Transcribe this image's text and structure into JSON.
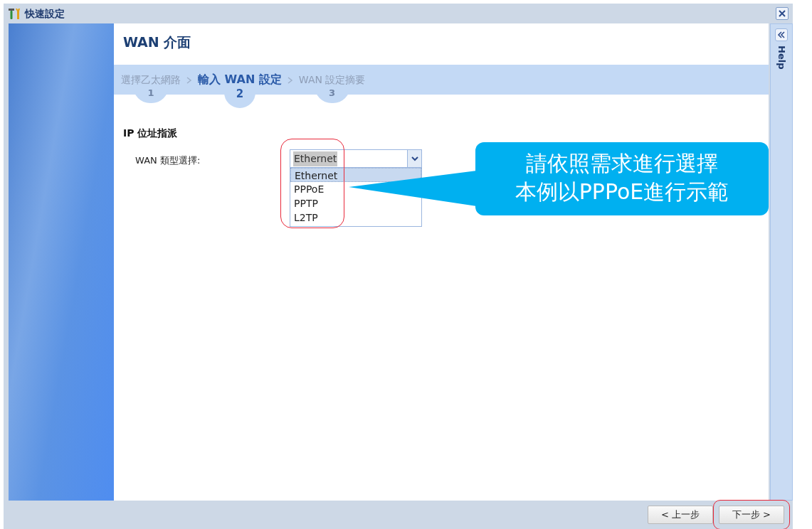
{
  "window": {
    "title": "快速設定"
  },
  "page_title": "WAN 介面",
  "steps": [
    {
      "label": "選擇乙太網路",
      "number": "1",
      "selected": false
    },
    {
      "label": "輸入 WAN 設定",
      "number": "2",
      "selected": true
    },
    {
      "label": "WAN 設定摘要",
      "number": "3",
      "selected": false
    }
  ],
  "section_title": "IP 位址指派",
  "wan_type": {
    "label": "WAN 類型選擇:",
    "value": "Ethernet",
    "expanded": true,
    "options": [
      {
        "label": "Ethernet",
        "selected": true
      },
      {
        "label": "PPPoE",
        "selected": false
      },
      {
        "label": "PPTP",
        "selected": false
      },
      {
        "label": "L2TP",
        "selected": false
      }
    ]
  },
  "help_panel": {
    "label": "Help"
  },
  "callout": {
    "lines": [
      "請依照需求進行選擇",
      "本例以PPPoE進行示範"
    ]
  },
  "buttons": [
    {
      "label": "< 上一步",
      "highlighted": false
    },
    {
      "label": "下一步 >",
      "highlighted": true
    }
  ]
}
